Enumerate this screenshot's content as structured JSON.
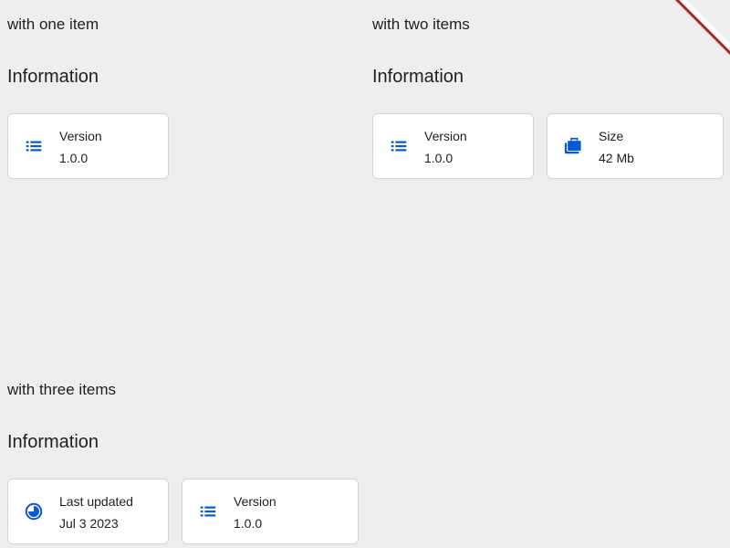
{
  "stories": [
    {
      "label": "with one item",
      "title": "Information",
      "items": [
        {
          "label": "Version",
          "value": "1.0.0",
          "icon": "list-icon"
        }
      ]
    },
    {
      "label": "with two items",
      "title": "Information",
      "items": [
        {
          "label": "Version",
          "value": "1.0.0",
          "icon": "list-icon"
        },
        {
          "label": "Size",
          "value": "42 Mb",
          "icon": "briefcase-icon"
        }
      ]
    },
    {
      "label": "with three items",
      "title": "Information",
      "items": [
        {
          "label": "Last updated",
          "value": "Jul 3 2023",
          "icon": "history-icon"
        },
        {
          "label": "Version",
          "value": "1.0.0",
          "icon": "list-icon"
        }
      ]
    }
  ],
  "colors": {
    "accent": "#0b57d0",
    "background": "#eeeeee",
    "card": "#ffffff",
    "ribbon": "#a52a2a"
  }
}
